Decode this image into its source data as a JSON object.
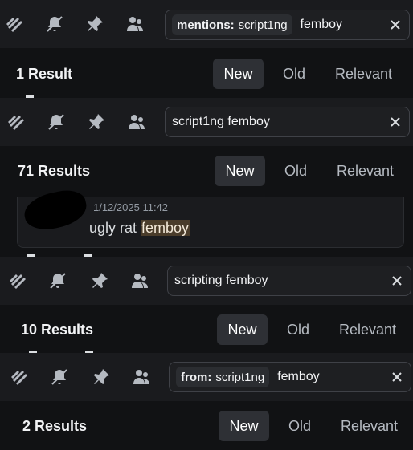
{
  "panels": [
    {
      "filter_key": "mentions:",
      "filter_value": "script1ng",
      "query": "femboy",
      "result_count": "1 Result",
      "sort": [
        "New",
        "Old",
        "Relevant"
      ],
      "active_sort": "New"
    },
    {
      "filter_key": "",
      "filter_value": "",
      "query": "script1ng femboy",
      "result_count": "71 Results",
      "sort": [
        "New",
        "Old",
        "Relevant"
      ],
      "active_sort": "New",
      "message": {
        "timestamp": "1/12/2025 11:42",
        "text_before": "ugly rat ",
        "highlight": "femboy"
      }
    },
    {
      "filter_key": "",
      "filter_value": "",
      "query": "scripting femboy",
      "result_count": "10 Results",
      "sort": [
        "New",
        "Old",
        "Relevant"
      ],
      "active_sort": "New"
    },
    {
      "filter_key": "from:",
      "filter_value": "script1ng",
      "query": "femboy",
      "result_count": "2 Results",
      "sort": [
        "New",
        "Old",
        "Relevant"
      ],
      "active_sort": "New"
    }
  ],
  "toolbar_icons": [
    "threads-icon",
    "mute-bell-icon",
    "pin-icon",
    "members-icon"
  ],
  "colors": {
    "background": "#111214",
    "toolbar": "#1a1b1e",
    "search_border": "#3f4147",
    "highlight": "#4a3c2a"
  }
}
